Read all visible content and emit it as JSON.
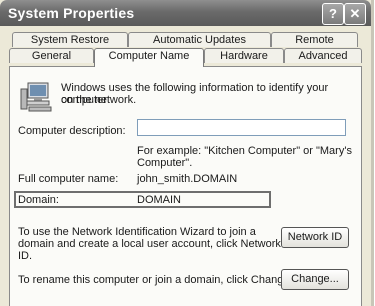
{
  "window": {
    "title": "System Properties",
    "help_btn": "?",
    "close_btn": "✕"
  },
  "tabs": {
    "row1": [
      "System Restore",
      "Automatic Updates",
      "Remote"
    ],
    "row2": [
      "General",
      "Computer Name",
      "Hardware",
      "Advanced"
    ]
  },
  "computer_name": {
    "intro_line1": "Windows uses the following information to identify your computer",
    "intro_line2": "on the network.",
    "description_label": "Computer description:",
    "description_value": "",
    "example_line1": "For example: \"Kitchen Computer\" or \"Mary's",
    "example_line2": "Computer\".",
    "full_name_label": "Full computer name:",
    "full_name_value": "john_smith.DOMAIN",
    "domain_label": "Domain:",
    "domain_value": "DOMAIN",
    "wizard_line1": "To use the Network Identification Wizard to join a",
    "wizard_line2": "domain and create a local user account, click Network",
    "wizard_line3": "ID.",
    "network_id_button": "Network ID",
    "rename_text": "To rename this computer or join a domain, click Change.",
    "change_button": "Change..."
  },
  "colors": {
    "titlebar": "#6a6a6a",
    "panel": "#fbfbf8",
    "window": "#ece9d8"
  }
}
